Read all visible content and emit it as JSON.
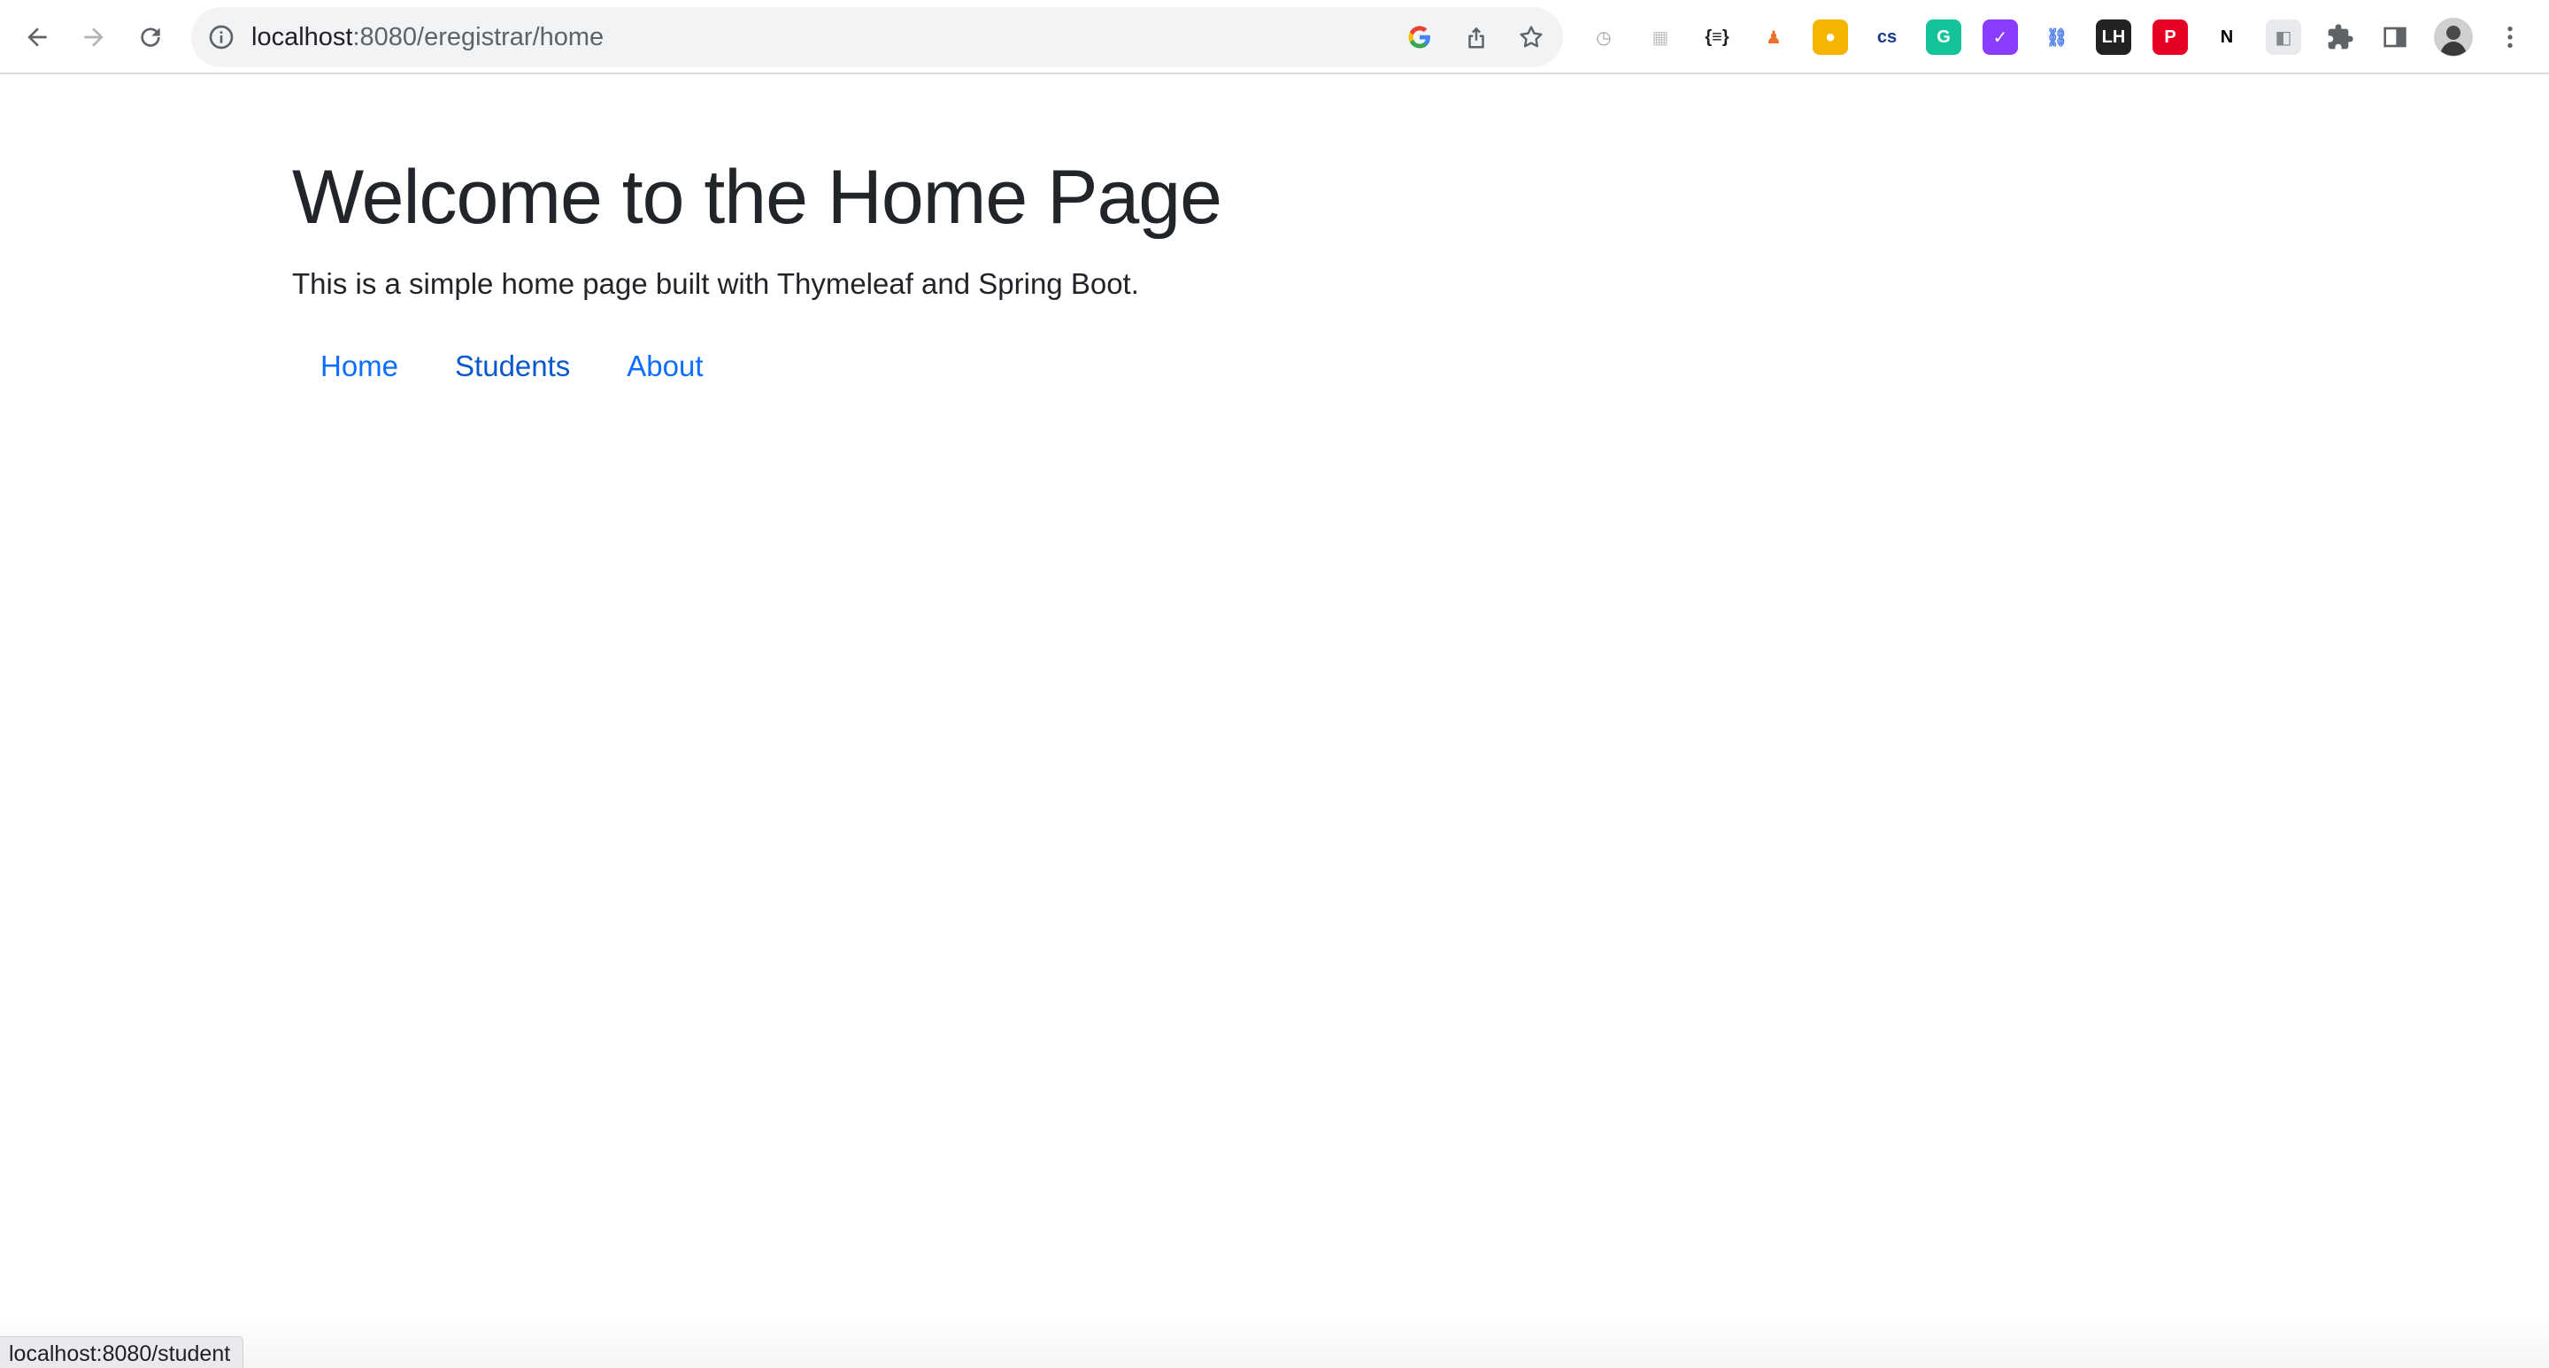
{
  "browser": {
    "url_host": "localhost",
    "url_rest": ":8080/eregistrar/home",
    "status_url": "localhost:8080/student"
  },
  "icons": {
    "back": "arrow-left-icon",
    "forward": "arrow-right-icon",
    "reload": "reload-icon",
    "site_info": "info-icon",
    "google": "google-icon",
    "share": "share-icon",
    "bookmark": "star-icon",
    "extensions": "puzzle-icon",
    "side_panel": "side-panel-icon",
    "profile": "avatar",
    "menu": "kebab-menu-icon"
  },
  "extensions": [
    {
      "name": "timer-extension-icon",
      "glyph": "◷",
      "color": "#9aa0a6",
      "bg": "#ffffff"
    },
    {
      "name": "grid-extension-icon",
      "glyph": "▦",
      "color": "#c0c4c8",
      "bg": "#ffffff"
    },
    {
      "name": "json-extension-icon",
      "glyph": "{≡}",
      "color": "#202124",
      "bg": "#ffffff"
    },
    {
      "name": "chess-extension-icon",
      "glyph": "♟",
      "color": "#e8702a",
      "bg": "#ffffff"
    },
    {
      "name": "keep-extension-icon",
      "glyph": "●",
      "color": "#ffffff",
      "bg": "#f4b400"
    },
    {
      "name": "css-extension-icon",
      "glyph": "cs",
      "color": "#1a3a8f",
      "bg": "#ffffff"
    },
    {
      "name": "grammarly-extension-icon",
      "glyph": "G",
      "color": "#ffffff",
      "bg": "#15c39a"
    },
    {
      "name": "purple-extension-icon",
      "glyph": "✓",
      "color": "#ffffff",
      "bg": "#8b3dff"
    },
    {
      "name": "link-extension-icon",
      "glyph": "⛓",
      "color": "#4a7dea",
      "bg": "#ffffff"
    },
    {
      "name": "lh-extension-icon",
      "glyph": "LH",
      "color": "#ffffff",
      "bg": "#222222"
    },
    {
      "name": "pinterest-extension-icon",
      "glyph": "P",
      "color": "#ffffff",
      "bg": "#e60023"
    },
    {
      "name": "notion-extension-icon",
      "glyph": "N",
      "color": "#000000",
      "bg": "#ffffff"
    },
    {
      "name": "photo-extension-icon",
      "glyph": "◧",
      "color": "#80868b",
      "bg": "#e8eaed"
    }
  ],
  "page": {
    "heading": "Welcome to the Home Page",
    "lead": "This is a simple home page built with Thymeleaf and Spring Boot.",
    "nav": [
      {
        "label": "Home"
      },
      {
        "label": "Students"
      },
      {
        "label": "About"
      }
    ]
  },
  "colors": {
    "link": "#0d6efd",
    "link_hover": "#0a58ca",
    "text": "#212529"
  }
}
